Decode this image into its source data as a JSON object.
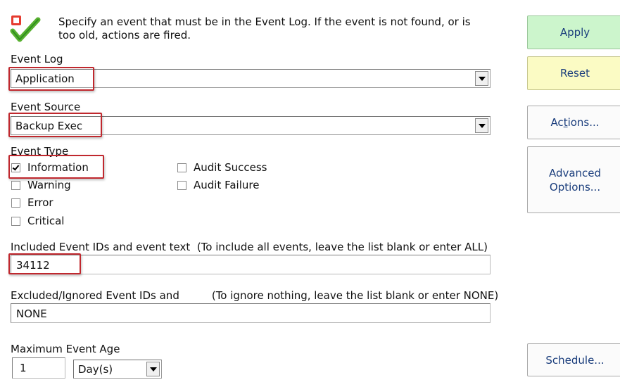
{
  "header": {
    "description": "Specify an event that must be in the Event Log.  If the event is not found, or is too old, actions are fired."
  },
  "event_log": {
    "label": "Event Log",
    "value": "Application"
  },
  "event_source": {
    "label": "Event Source",
    "value": "Backup Exec"
  },
  "event_type": {
    "label": "Event Type",
    "options": [
      {
        "label": "Information",
        "checked": true
      },
      {
        "label": "Warning",
        "checked": false
      },
      {
        "label": "Error",
        "checked": false
      },
      {
        "label": "Critical",
        "checked": false
      },
      {
        "label": "Audit Success",
        "checked": false
      },
      {
        "label": "Audit Failure",
        "checked": false
      }
    ]
  },
  "included": {
    "label": "Included Event IDs and event text",
    "hint": "(To include all events, leave the list blank or enter ALL)",
    "value": "34112"
  },
  "excluded": {
    "label": "Excluded/Ignored Event IDs and",
    "hint": "(To ignore nothing, leave the list blank or enter NONE)",
    "value": "NONE"
  },
  "max_age": {
    "label": "Maximum Event Age",
    "value": "1",
    "unit": "Day(s)"
  },
  "buttons": {
    "apply": "Apply",
    "reset": "Reset",
    "actions_pre": "Ac",
    "actions_u": "t",
    "actions_post": "ions...",
    "advanced_line1": "Advanced",
    "advanced_line2": "Options...",
    "schedule": "Schedule..."
  },
  "colors": {
    "apply_bg": "#ccf5cc",
    "reset_bg": "#fbfbc4",
    "highlight": "#c0282e",
    "button_text": "#1a3d7c"
  },
  "icons": {
    "header_icon": "checkmark-shield-icon"
  }
}
